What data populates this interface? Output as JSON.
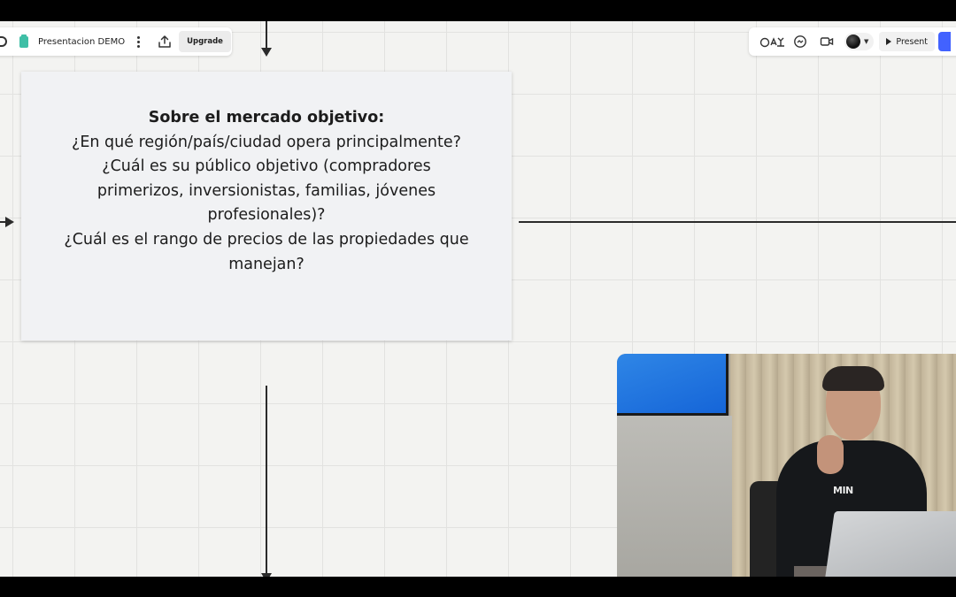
{
  "toolbar_left": {
    "board_title": "Presentacion DEMO",
    "upgrade_label": "Upgrade"
  },
  "toolbar_right": {
    "present_label": "Present"
  },
  "card": {
    "title": "Sobre el mercado objetivo:",
    "lines": [
      "¿En qué región/país/ciudad opera principalmente?",
      "¿Cuál es su público objetivo (compradores",
      "primerizos, inversionistas, familias, jóvenes",
      "profesionales)?",
      "¿Cuál es el rango de precios de las propiedades que",
      "manejan?"
    ]
  },
  "webcam": {
    "shirt_text": "MIN"
  },
  "colors": {
    "canvas_bg": "#f3f3f1",
    "grid": "#e2e2e0",
    "card_bg": "#f1f2f4",
    "connector": "#2b2b2b",
    "board_icon": "#3fbfa6",
    "share_button": "#4262ff"
  }
}
